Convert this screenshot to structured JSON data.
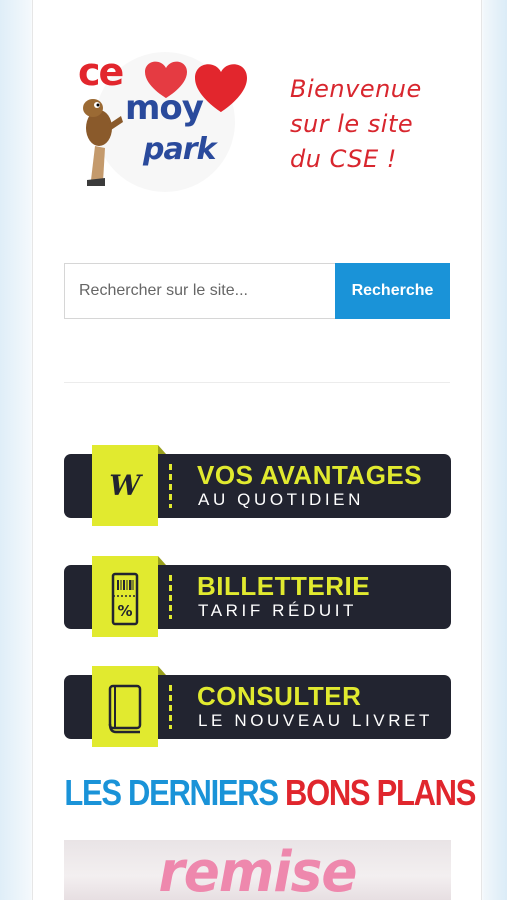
{
  "header": {
    "logo": {
      "name": "ce moy park",
      "text_line1": "ce",
      "text_line2": "moy",
      "text_line3": "park"
    },
    "welcome_lines": [
      "Bienvenue",
      "sur le site",
      "du CSE !"
    ],
    "welcome_color": "#d8262e"
  },
  "search": {
    "placeholder": "Rechercher sur le site...",
    "value": "",
    "button_label": "Recherche",
    "button_color": "#1a93d8"
  },
  "banners": [
    {
      "icon": "w-logo-icon",
      "title": "VOS AVANTAGES",
      "subtitle": "AU QUOTIDIEN"
    },
    {
      "icon": "ticket-percent-icon",
      "title": "BILLETTERIE",
      "subtitle": "TARIF RÉDUIT"
    },
    {
      "icon": "book-icon",
      "title": "CONSULTER",
      "subtitle": "LE NOUVEAU LIVRET"
    }
  ],
  "banner_colors": {
    "background": "#222430",
    "accent": "#e1ea2f"
  },
  "section": {
    "title_part1": "LES DERNIERS",
    "title_part2": "BONS PLANS",
    "color_part1": "#1a93d8",
    "color_part2": "#e0262d"
  },
  "promo": {
    "text": "remise",
    "color": "#ee88ad"
  }
}
